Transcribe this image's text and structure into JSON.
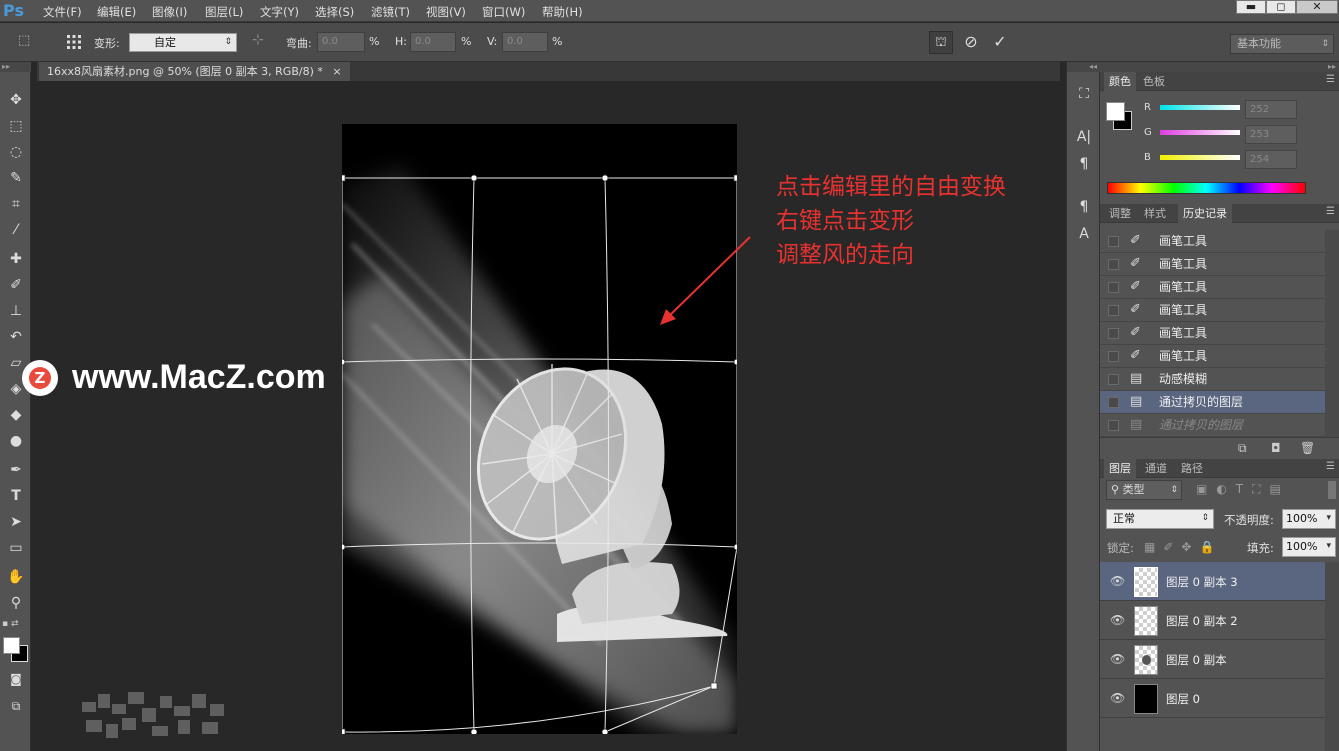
{
  "app": {
    "logo": "Ps"
  },
  "menu": [
    "文件(F)",
    "编辑(E)",
    "图像(I)",
    "图层(L)",
    "文字(Y)",
    "选择(S)",
    "滤镜(T)",
    "视图(V)",
    "窗口(W)",
    "帮助(H)"
  ],
  "window_controls": {
    "minimize": "▬",
    "maximize": "◻",
    "close": "✕"
  },
  "options": {
    "warp_label": "变形:",
    "warp_value": "自定",
    "bend_label": "弯曲:",
    "bend_value": "0.0",
    "h_label": "H:",
    "h_value": "0.0",
    "v_label": "V:",
    "v_value": "0.0",
    "percent": "%",
    "workspace": "基本功能"
  },
  "document": {
    "tab_title": "16xx8风扇素材.png @ 50% (图层 0 副本 3, RGB/8) *",
    "close": "×"
  },
  "annotation": {
    "line1": "点击编辑里的自由变换",
    "line2": "右键点击变形",
    "line3": "调整风的走向"
  },
  "watermark": {
    "text": "www.MacZ.com",
    "logo_letter": "Z"
  },
  "color_panel": {
    "tabs": [
      "颜色",
      "色板"
    ],
    "channels": [
      {
        "name": "R",
        "value": "252",
        "color": "#00e0e8"
      },
      {
        "name": "G",
        "value": "253",
        "color": "#e040e0"
      },
      {
        "name": "B",
        "value": "254",
        "color": "#f0f000"
      }
    ]
  },
  "history_panel": {
    "tabs": [
      "调整",
      "样式",
      "历史记录"
    ],
    "items": [
      {
        "label": "画笔工具",
        "type": "brush"
      },
      {
        "label": "画笔工具",
        "type": "brush"
      },
      {
        "label": "画笔工具",
        "type": "brush"
      },
      {
        "label": "画笔工具",
        "type": "brush"
      },
      {
        "label": "画笔工具",
        "type": "brush"
      },
      {
        "label": "画笔工具",
        "type": "brush"
      },
      {
        "label": "动感模糊",
        "type": "doc"
      },
      {
        "label": "通过拷贝的图层",
        "type": "doc",
        "selected": true
      },
      {
        "label": "通过拷贝的图层",
        "type": "doc",
        "dimmed": true
      }
    ]
  },
  "layers_panel": {
    "tabs": [
      "图层",
      "通道",
      "路径"
    ],
    "filter_label": "类型",
    "blend_mode": "正常",
    "opacity_label": "不透明度:",
    "opacity_value": "100%",
    "lock_label": "锁定:",
    "fill_label": "填充:",
    "fill_value": "100%",
    "layers": [
      {
        "name": "图层 0 副本 3",
        "thumb": "checker",
        "selected": true
      },
      {
        "name": "图层 0 副本 2",
        "thumb": "checker"
      },
      {
        "name": "图层 0 副本",
        "thumb": "fan"
      },
      {
        "name": "图层 0",
        "thumb": "black"
      }
    ]
  }
}
